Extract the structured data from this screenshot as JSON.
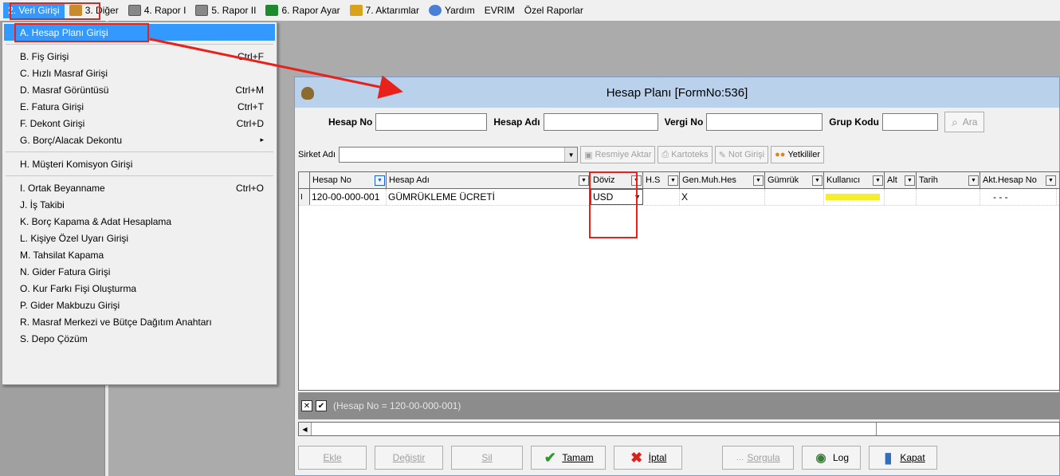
{
  "menubar": {
    "items": [
      {
        "label": "2. Veri Girişi",
        "icon": "data-entry-icon"
      },
      {
        "label": "3. Diğer",
        "icon": "other-icon"
      },
      {
        "label": "4. Rapor I",
        "icon": "printer-icon"
      },
      {
        "label": "5. Rapor II",
        "icon": "printer-icon"
      },
      {
        "label": "6. Rapor Ayar",
        "icon": "report-settings-icon"
      },
      {
        "label": "7. Aktarımlar",
        "icon": "transfer-icon"
      },
      {
        "label": "Yardım",
        "icon": "help-icon"
      },
      {
        "label": "EVRIM",
        "icon": ""
      },
      {
        "label": "Özel Raporlar",
        "icon": ""
      }
    ]
  },
  "dropdown": {
    "items": [
      {
        "label": "A. Hesap Planı Girişi",
        "shortcut": ""
      },
      {
        "label": "B. Fiş Girişi",
        "shortcut": "Ctrl+F"
      },
      {
        "label": "C. Hızlı Masraf Girişi",
        "shortcut": ""
      },
      {
        "label": "D. Masraf Görüntüsü",
        "shortcut": "Ctrl+M"
      },
      {
        "label": "E. Fatura Girişi",
        "shortcut": "Ctrl+T"
      },
      {
        "label": "F. Dekont Girişi",
        "shortcut": "Ctrl+D"
      },
      {
        "label": "G. Borç/Alacak Dekontu",
        "shortcut": "▸"
      },
      {
        "label": "H. Müşteri Komisyon Girişi",
        "shortcut": ""
      },
      {
        "label": "I. Ortak Beyanname",
        "shortcut": "Ctrl+O"
      },
      {
        "label": "J. İş Takibi",
        "shortcut": ""
      },
      {
        "label": "K. Borç Kapama & Adat Hesaplama",
        "shortcut": ""
      },
      {
        "label": "L. Kişiye Özel Uyarı Girişi",
        "shortcut": ""
      },
      {
        "label": "M. Tahsilat Kapama",
        "shortcut": ""
      },
      {
        "label": "N. Gider Fatura Girişi",
        "shortcut": ""
      },
      {
        "label": "O. Kur Farkı Fişi Oluşturma",
        "shortcut": ""
      },
      {
        "label": "P. Gider Makbuzu Girişi",
        "shortcut": ""
      },
      {
        "label": "R. Masraf Merkezi ve Bütçe Dağıtım Anahtarı",
        "shortcut": ""
      },
      {
        "label": "S. Depo Çözüm",
        "shortcut": ""
      }
    ]
  },
  "window": {
    "title": "Hesap Planı [FormNo:536]",
    "search": {
      "hesap_no_label": "Hesap No",
      "hesap_adi_label": "Hesap Adı",
      "vergi_no_label": "Vergi No",
      "grup_kodu_label": "Grup Kodu",
      "ara_label": "Ara"
    },
    "toolbar": {
      "sirket_label": "Sirket Adı",
      "resmiye_aktar": "Resmiye Aktar",
      "kartoteks": "Kartoteks",
      "not_girisi": "Not Girişi",
      "yetkililer": "Yetkililer"
    },
    "grid": {
      "columns": [
        "Hesap No",
        "Hesap Adı",
        "Döviz",
        "H.S",
        "Gen.Muh.Hes",
        "Gümrük",
        "Kullanıcı",
        "Alt",
        "Tarih",
        "Akt.Hesap No"
      ],
      "row": {
        "indicator": "I",
        "hesap_no": "120-00-000-001",
        "hesap_adi": "GÜMRÜKLEME ÜCRETİ",
        "doviz": "USD",
        "hs": "",
        "gen_muh_hes": "X",
        "gumruk": "",
        "kullanici": "",
        "alt": "",
        "tarih": "",
        "akt_hesap_no": "- - -"
      }
    },
    "filter_text": "(Hesap No = 120-00-000-001)",
    "buttons": {
      "ekle": "Ekle",
      "degistir": "Değiştir",
      "sil": "Sil",
      "tamam": "Tamam",
      "iptal": "İptal",
      "sorgula": "Sorgula",
      "log": "Log",
      "kapat": "Kapat"
    }
  },
  "colors": {
    "highlight": "#3399ff",
    "annotation_red": "#e8221a",
    "titlebar": "#b9d1ea"
  }
}
